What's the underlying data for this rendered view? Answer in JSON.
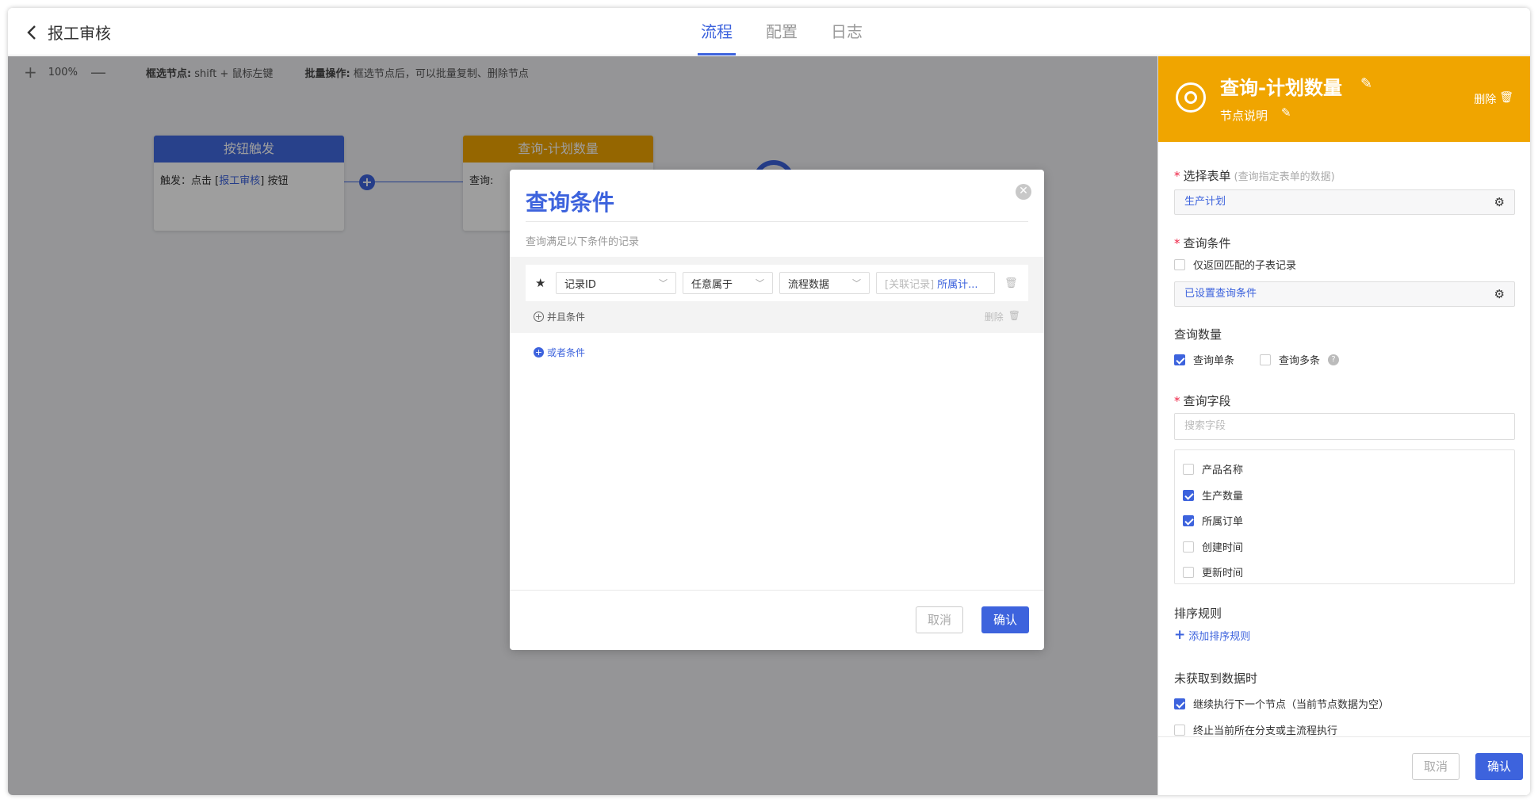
{
  "header": {
    "title": "报工审核",
    "tabs": [
      "流程",
      "配置",
      "日志"
    ]
  },
  "toolbar": {
    "zoom": "100%",
    "hint1_label": "框选节点:",
    "hint1_text": "shift + 鼠标左键",
    "hint2_label": "批量操作:",
    "hint2_text": "框选节点后，可以批量复制、删除节点"
  },
  "nodes": {
    "trigger": {
      "title": "按钮触发",
      "body_prefix": "触发：点击 [",
      "body_link": "报工审核",
      "body_suffix": "] 按钮",
      "color": "#4169e1"
    },
    "query": {
      "title": "查询-计划数量",
      "body": "查询:",
      "color": "#f0a500"
    }
  },
  "modal": {
    "title": "查询条件",
    "subtitle": "查询满足以下条件的记录",
    "field_select": "记录ID",
    "operator_select": "任意属于",
    "source_select": "流程数据",
    "ref_prefix": "[关联记录]",
    "ref_value": "所属计...",
    "and_condition": "并且条件",
    "delete": "删除",
    "or_condition": "或者条件",
    "cancel": "取消",
    "confirm": "确认"
  },
  "panel": {
    "title": "查询-计划数量",
    "node_desc": "节点说明",
    "delete": "删除",
    "select_form_label": "选择表单",
    "select_form_hint": "(查询指定表单的数据)",
    "select_form_value": "生产计划",
    "query_cond_label": "查询条件",
    "only_matched_subrecords": "仅返回匹配的子表记录",
    "query_cond_value": "已设置查询条件",
    "query_count_label": "查询数量",
    "query_single": "查询单条",
    "query_multiple": "查询多条",
    "help_mark": "?",
    "query_fields_label": "查询字段",
    "search_placeholder": "搜索字段",
    "fields": [
      {
        "name": "产品名称",
        "checked": false
      },
      {
        "name": "生产数量",
        "checked": true
      },
      {
        "name": "所属订单",
        "checked": true
      },
      {
        "name": "创建时间",
        "checked": false
      },
      {
        "name": "更新时间",
        "checked": false
      }
    ],
    "sort_label": "排序规则",
    "add_sort": "添加排序规则",
    "no_data_label": "未获取到数据时",
    "continue_next": "继续执行下一个节点（当前节点数据为空）",
    "terminate": "终止当前所在分支或主流程执行",
    "cancel": "取消",
    "confirm": "确认"
  },
  "colors": {
    "accent": "#3d63dd",
    "panel_header": "#f0a500"
  }
}
